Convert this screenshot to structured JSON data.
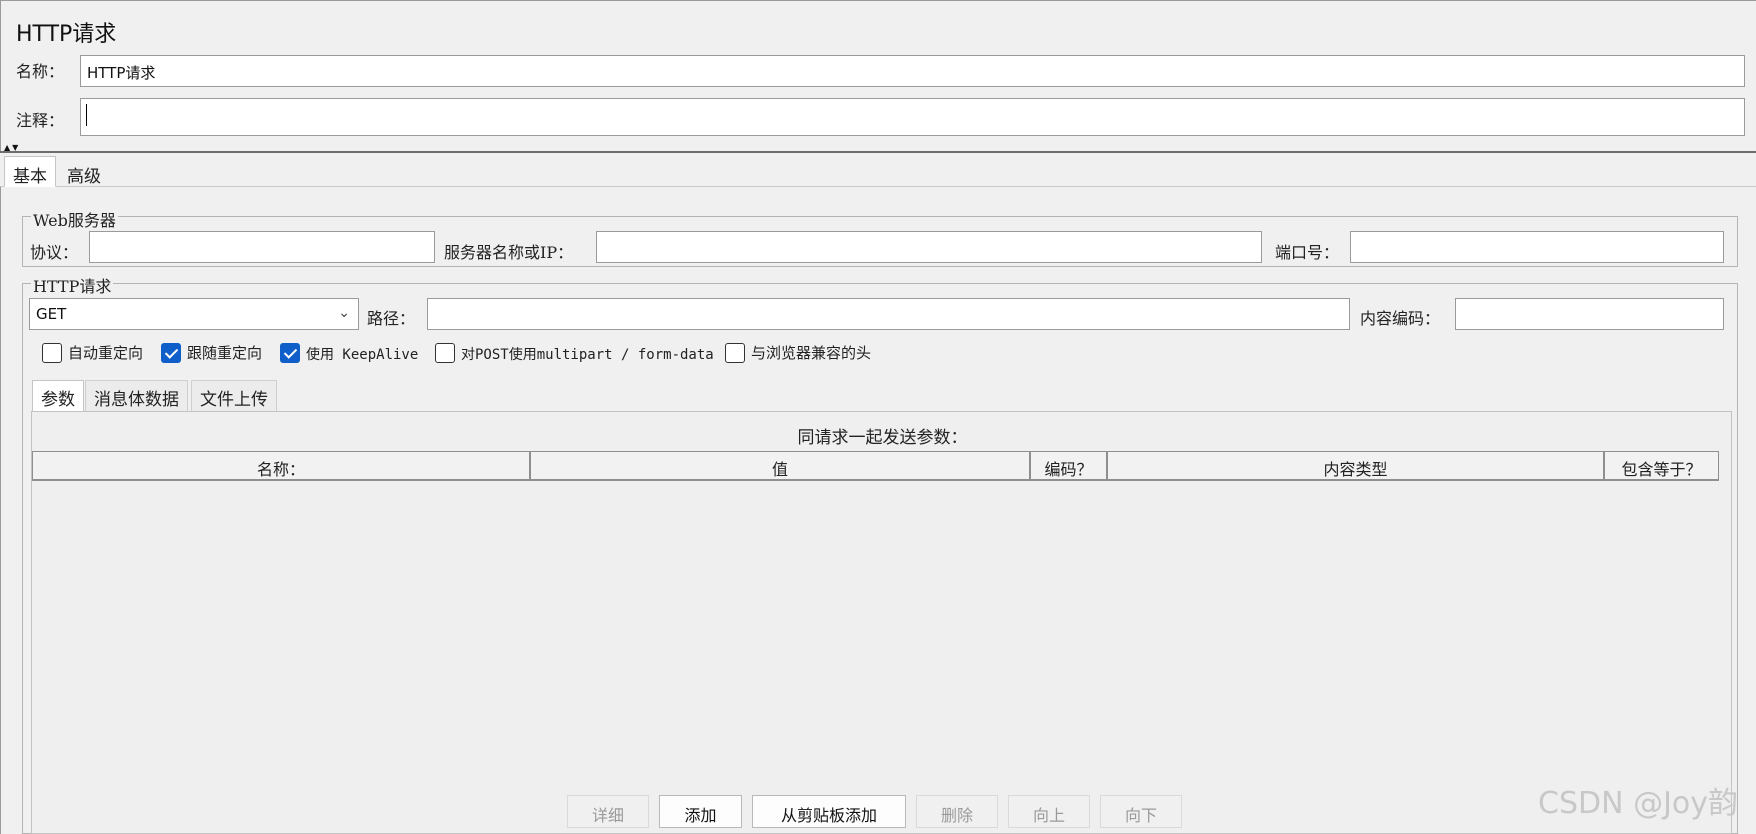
{
  "header": {
    "title": "HTTP请求",
    "name_label": "名称：",
    "name_value": "HTTP请求",
    "comment_label": "注释：",
    "comment_value": ""
  },
  "tabs": {
    "basic": "基本",
    "advanced": "高级"
  },
  "web_server": {
    "legend": "Web服务器",
    "protocol_label": "协议：",
    "protocol_value": "",
    "server_label": "服务器名称或IP：",
    "server_value": "",
    "port_label": "端口号：",
    "port_value": ""
  },
  "http_request": {
    "legend": "HTTP请求",
    "method": "GET",
    "path_label": "路径：",
    "path_value": "",
    "encoding_label": "内容编码：",
    "encoding_value": ""
  },
  "options": [
    {
      "label": "自动重定向",
      "checked": false
    },
    {
      "label": "跟随重定向",
      "checked": true
    },
    {
      "label": "使用 KeepAlive",
      "checked": true
    },
    {
      "label": "对POST使用multipart / form-data",
      "checked": false
    },
    {
      "label": "与浏览器兼容的头",
      "checked": false
    }
  ],
  "inner_tabs": {
    "params": "参数",
    "body": "消息体数据",
    "files": "文件上传"
  },
  "params_table": {
    "caption": "同请求一起发送参数：",
    "columns": [
      "名称：",
      "值",
      "编码？",
      "内容类型",
      "包含等于？"
    ]
  },
  "buttons": {
    "detail": "详细",
    "add": "添加",
    "add_clipboard": "从剪贴板添加",
    "delete": "删除",
    "up": "向上",
    "down": "向下"
  },
  "watermark": "CSDN @Joy韵"
}
